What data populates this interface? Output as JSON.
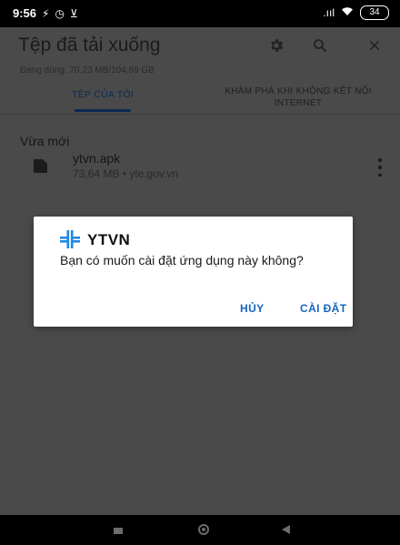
{
  "status_bar": {
    "time": "9:56",
    "left_icons": [
      "⚡",
      "◷",
      "⊻"
    ],
    "signal": ".ııl",
    "wifi": "wifi",
    "battery": "34"
  },
  "appbar": {
    "title": "Tệp đã tải xuống",
    "icons": [
      "gear-icon",
      "search-icon",
      "close-icon"
    ]
  },
  "storage": {
    "text": "Đang dùng: 70,23 MB/104,69 GB"
  },
  "tabs": [
    {
      "label": "TỆP CỦA TÔI",
      "selected": true
    },
    {
      "label_line1": "KHÁM PHÁ KHI KHÔNG KẾT NỐI",
      "label_line2": "INTERNET",
      "selected": false
    }
  ],
  "section": {
    "title": "Vừa mới"
  },
  "files": [
    {
      "name": "ytvn.apk",
      "meta": "73,64 MB • yte.gov.vn"
    }
  ],
  "dialog": {
    "app_name": "YTVN",
    "message": "Bạn có muốn cài đặt ứng dụng này không?",
    "cancel_label": "HỦY",
    "install_label": "CÀI ĐẶT",
    "accent_color": "#1565c0",
    "logo_color": "#1e88e5"
  },
  "colors": {
    "scrim_background": "#4a4a4a",
    "tab_indicator": "#0b2a50"
  }
}
